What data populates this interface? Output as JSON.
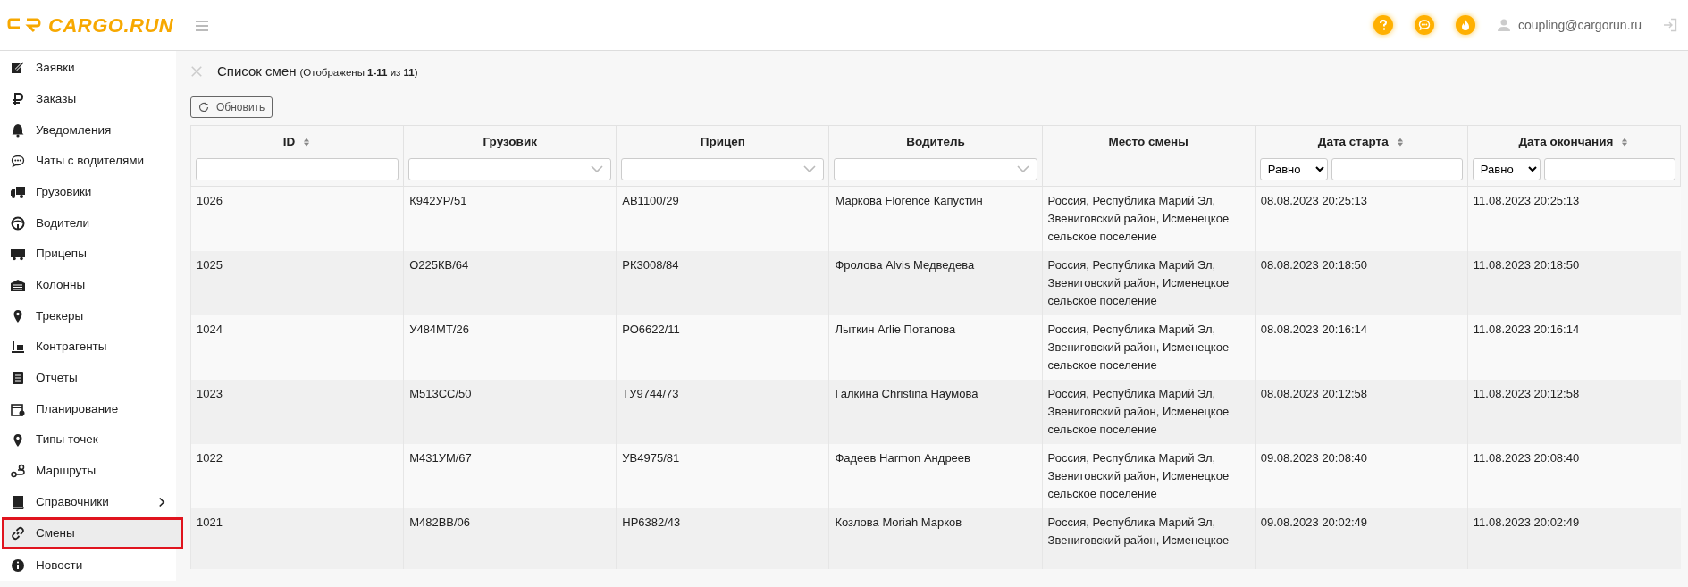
{
  "header": {
    "logo": "CARGO.RUN",
    "user": "coupling@cargorun.ru"
  },
  "sidebar": {
    "items": [
      {
        "label": "Заявки",
        "selected": false,
        "has_submenu": false
      },
      {
        "label": "Заказы",
        "selected": false,
        "has_submenu": false
      },
      {
        "label": "Уведомления",
        "selected": false,
        "has_submenu": false
      },
      {
        "label": "Чаты с водителями",
        "selected": false,
        "has_submenu": false
      },
      {
        "label": "Грузовики",
        "selected": false,
        "has_submenu": false
      },
      {
        "label": "Водители",
        "selected": false,
        "has_submenu": false
      },
      {
        "label": "Прицепы",
        "selected": false,
        "has_submenu": false
      },
      {
        "label": "Колонны",
        "selected": false,
        "has_submenu": false
      },
      {
        "label": "Трекеры",
        "selected": false,
        "has_submenu": false
      },
      {
        "label": "Контрагенты",
        "selected": false,
        "has_submenu": false
      },
      {
        "label": "Отчеты",
        "selected": false,
        "has_submenu": false
      },
      {
        "label": "Планирование",
        "selected": false,
        "has_submenu": false
      },
      {
        "label": "Типы точек",
        "selected": false,
        "has_submenu": false
      },
      {
        "label": "Маршруты",
        "selected": false,
        "has_submenu": false
      },
      {
        "label": "Справочники",
        "selected": false,
        "has_submenu": true
      },
      {
        "label": "Смены",
        "selected": true,
        "has_submenu": false,
        "highlighted": true
      },
      {
        "label": "Новости",
        "selected": false,
        "has_submenu": false
      }
    ]
  },
  "page": {
    "title": "Список смен",
    "count": "(Отображены **1-11** из **11**)",
    "refresh_button": "Обновить"
  },
  "table": {
    "columns": [
      {
        "label": "ID",
        "sortable": true,
        "filter": {
          "kind": "text"
        }
      },
      {
        "label": "Грузовик",
        "sortable": false,
        "filter": {
          "kind": "select"
        }
      },
      {
        "label": "Прицеп",
        "sortable": false,
        "filter": {
          "kind": "select"
        }
      },
      {
        "label": "Водитель",
        "sortable": false,
        "filter": {
          "kind": "select"
        }
      },
      {
        "label": "Место смены",
        "sortable": false,
        "filter": {
          "kind": "none"
        }
      },
      {
        "label": "Дата старта",
        "sortable": true,
        "filter": {
          "kind": "date",
          "operator": "Равно"
        }
      },
      {
        "label": "Дата окончания",
        "sortable": true,
        "filter": {
          "kind": "date",
          "operator": "Равно"
        }
      }
    ],
    "rows": [
      [
        "1026",
        "К942УР/51",
        "АВ1100/29",
        "Маркова Florence Капустин",
        "Россия, Республика Марий Эл, Звениговский район, Исменецкое сельское поселение",
        "08.08.2023 20:25:13",
        "11.08.2023 20:25:13"
      ],
      [
        "1025",
        "О225КВ/64",
        "РК3008/84",
        "Фролова Alvis Медведева",
        "Россия, Республика Марий Эл, Звениговский район, Исменецкое сельское поселение",
        "08.08.2023 20:18:50",
        "11.08.2023 20:18:50"
      ],
      [
        "1024",
        "У484МТ/26",
        "РО6622/11",
        "Лыткин Arlie Потапова",
        "Россия, Республика Марий Эл, Звениговский район, Исменецкое сельское поселение",
        "08.08.2023 20:16:14",
        "11.08.2023 20:16:14"
      ],
      [
        "1023",
        "М513СС/50",
        "ТУ9744/73",
        "Галкина Christina Наумова",
        "Россия, Республика Марий Эл, Звениговский район, Исменецкое сельское поселение",
        "08.08.2023 20:12:58",
        "11.08.2023 20:12:58"
      ],
      [
        "1022",
        "М431УМ/67",
        "УВ4975/81",
        "Фадеев Harmon Андреев",
        "Россия, Республика Марий Эл, Звениговский район, Исменецкое сельское поселение",
        "09.08.2023 20:08:40",
        "11.08.2023 20:08:40"
      ],
      [
        "1021",
        "М482ВВ/06",
        "НР6382/43",
        "Козлова Moriah Марков",
        "Россия, Республика Марий Эл, Звениговский район, Исменецкое",
        "09.08.2023 20:02:49",
        "11.08.2023 20:02:49"
      ]
    ]
  }
}
